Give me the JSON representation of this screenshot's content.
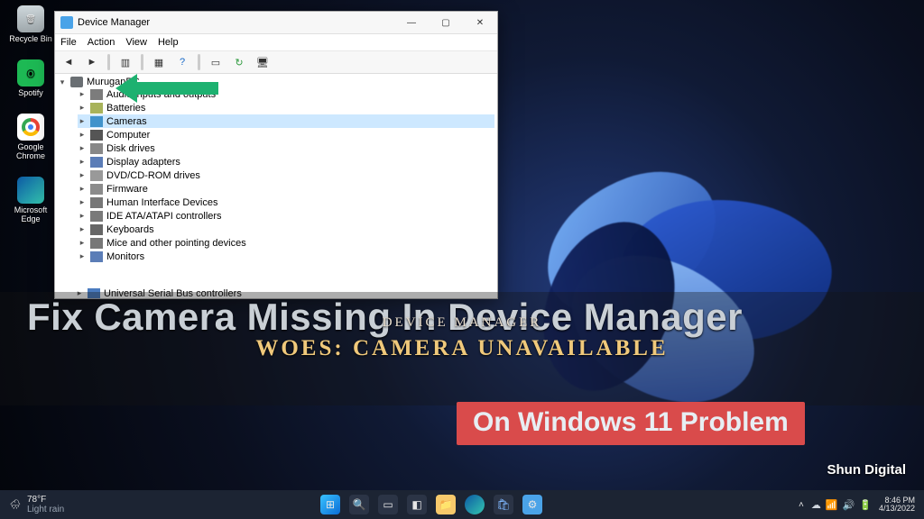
{
  "captions": {
    "line_top": "Fix Camera Missing In Device Manager",
    "red_box": "On Windows 11 Problem",
    "center1": "DEVICE MANAGER",
    "center2": "WOES: CAMERA UNAVAILABLE",
    "watermark": "Shun Digital"
  },
  "desktop_icons": [
    {
      "name": "recycle-bin",
      "label": "Recycle Bin"
    },
    {
      "name": "spotify",
      "label": "Spotify"
    },
    {
      "name": "google-chrome",
      "label": "Google Chrome"
    },
    {
      "name": "microsoft-edge",
      "label": "Microsoft Edge"
    }
  ],
  "window": {
    "title": "Device Manager",
    "menu": [
      "File",
      "Action",
      "View",
      "Help"
    ],
    "root": "MuruganPC",
    "items": [
      {
        "label": "Audio inputs and outputs",
        "icon": "audio"
      },
      {
        "label": "Batteries",
        "icon": "bat"
      },
      {
        "label": "Cameras",
        "icon": "cam",
        "selected": true
      },
      {
        "label": "Computer",
        "icon": "comp"
      },
      {
        "label": "Disk drives",
        "icon": "disk"
      },
      {
        "label": "Display adapters",
        "icon": "disp"
      },
      {
        "label": "DVD/CD-ROM drives",
        "icon": "dvd"
      },
      {
        "label": "Firmware",
        "icon": "fw"
      },
      {
        "label": "Human Interface Devices",
        "icon": "hid"
      },
      {
        "label": "IDE ATA/ATAPI controllers",
        "icon": "ide"
      },
      {
        "label": "Keyboards",
        "icon": "kb"
      },
      {
        "label": "Mice and other pointing devices",
        "icon": "mouse"
      },
      {
        "label": "Monitors",
        "icon": "mon"
      }
    ],
    "partial_item": {
      "label": "Universal Serial Bus controllers",
      "icon": "usb"
    }
  },
  "taskbar": {
    "weather_temp": "78°F",
    "weather_desc": "Light rain",
    "time": "8:46 PM",
    "date": "4/13/2022"
  },
  "colors": {
    "arrow": "#1db170",
    "highlight": "#cde8ff",
    "redbox": "#d94b4b",
    "caption": "#f0c97b"
  }
}
